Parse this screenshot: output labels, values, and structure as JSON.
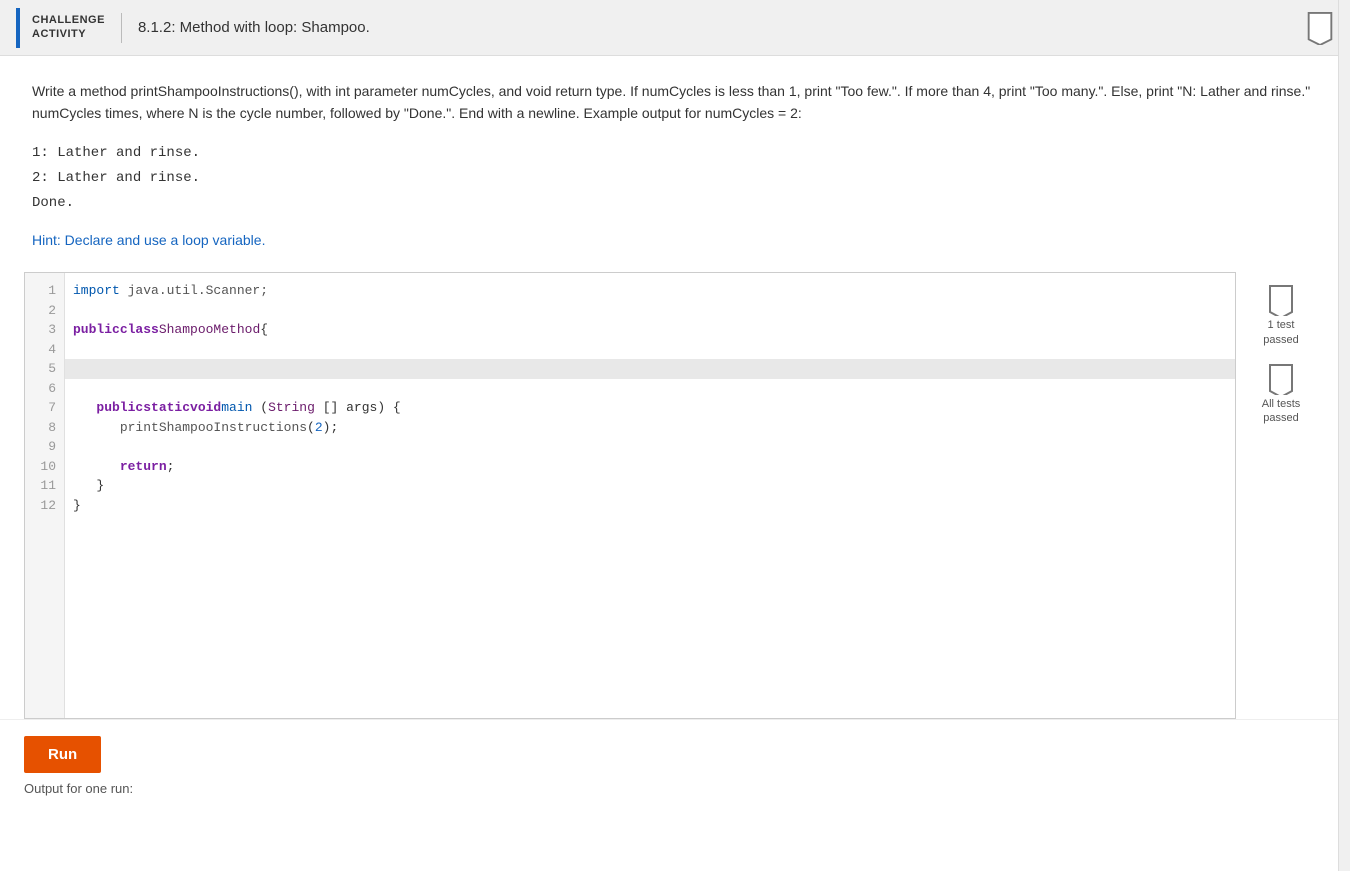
{
  "header": {
    "challenge_label_line1": "CHALLENGE",
    "challenge_label_line2": "ACTIVITY",
    "title": "8.1.2: Method with loop: Shampoo."
  },
  "description": {
    "paragraph": "Write a method printShampooInstructions(), with int parameter numCycles, and void return type. If numCycles is less than 1, print \"Too few.\". If more than 4, print \"Too many.\". Else, print \"N: Lather and rinse.\" numCycles times, where N is the cycle number, followed by \"Done.\". End with a newline. Example output for numCycles = 2:",
    "code_example_lines": [
      "1: Lather and rinse.",
      "2: Lather and rinse.",
      "Done."
    ],
    "hint": "Hint: Declare and use a loop variable."
  },
  "editor": {
    "lines": [
      {
        "num": 1,
        "text": "import java.util.Scanner;",
        "active": false
      },
      {
        "num": 2,
        "text": "",
        "active": false
      },
      {
        "num": 3,
        "text": "public class ShampooMethod {",
        "active": false
      },
      {
        "num": 4,
        "text": "",
        "active": false
      },
      {
        "num": 5,
        "text": "",
        "active": true
      },
      {
        "num": 6,
        "text": "",
        "active": false
      },
      {
        "num": 7,
        "text": "   public static void main (String [] args) {",
        "active": false
      },
      {
        "num": 8,
        "text": "      printShampooInstructions(2);",
        "active": false
      },
      {
        "num": 9,
        "text": "",
        "active": false
      },
      {
        "num": 10,
        "text": "      return;",
        "active": false
      },
      {
        "num": 11,
        "text": "   }",
        "active": false
      },
      {
        "num": 12,
        "text": "}",
        "active": false
      }
    ]
  },
  "test_results": {
    "test1_label": "1 test\npassed",
    "test2_label": "All tests\npassed"
  },
  "run_button_label": "Run",
  "output_label": "Output for one run:"
}
